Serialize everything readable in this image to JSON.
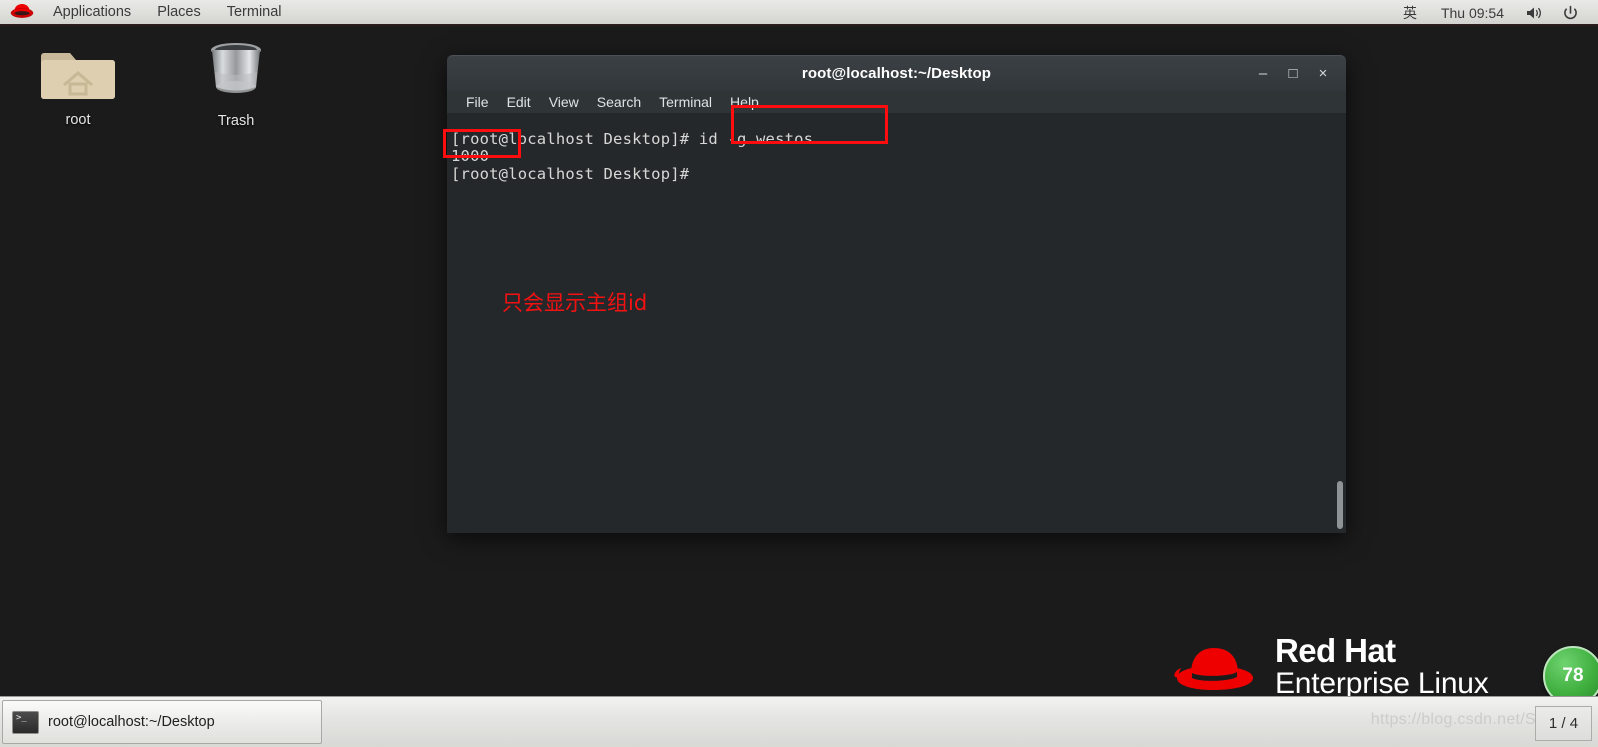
{
  "top_panel": {
    "logo_icon": "redhat-logo-icon",
    "menus": [
      {
        "label": "Applications",
        "name": "applications-menu"
      },
      {
        "label": "Places",
        "name": "places-menu"
      },
      {
        "label": "Terminal",
        "name": "terminal-menu"
      }
    ],
    "input_method": "英",
    "clock": "Thu 09:54",
    "volume_icon": "volume-icon",
    "power_icon": "power-icon"
  },
  "desktop": {
    "icons": [
      {
        "label": "root",
        "icon": "home-folder-icon"
      },
      {
        "label": "Trash",
        "icon": "trash-can-icon"
      }
    ],
    "branding": {
      "line1": "Red Hat",
      "line2": "Enterprise Linux",
      "logo_icon": "redhat-fedora-icon",
      "logo_color": "#ee0000"
    },
    "badge": {
      "text": "78",
      "color": "#3faf3f"
    }
  },
  "terminal": {
    "title": "root@localhost:~/Desktop",
    "menus": [
      {
        "label": "File",
        "name": "file-menu"
      },
      {
        "label": "Edit",
        "name": "edit-menu"
      },
      {
        "label": "View",
        "name": "view-menu"
      },
      {
        "label": "Search",
        "name": "search-menu"
      },
      {
        "label": "Terminal",
        "name": "terminal-menu"
      },
      {
        "label": "Help",
        "name": "help-menu"
      }
    ],
    "window_controls": {
      "minimize": "–",
      "maximize": "□",
      "close": "×"
    },
    "content": "[root@localhost Desktop]# id -g westos\n1000\n[root@localhost Desktop]#"
  },
  "annotations": {
    "command_box_label": "id -g westos",
    "output_box_label": "1000",
    "note": "只会显示主组id",
    "color": "#fd0d0d"
  },
  "taskbar": {
    "window_button": {
      "label": "root@localhost:~/Desktop",
      "icon": "terminal-icon"
    },
    "workspace": "1 / 4",
    "watermark": "https://blog.csdn.net/S"
  }
}
